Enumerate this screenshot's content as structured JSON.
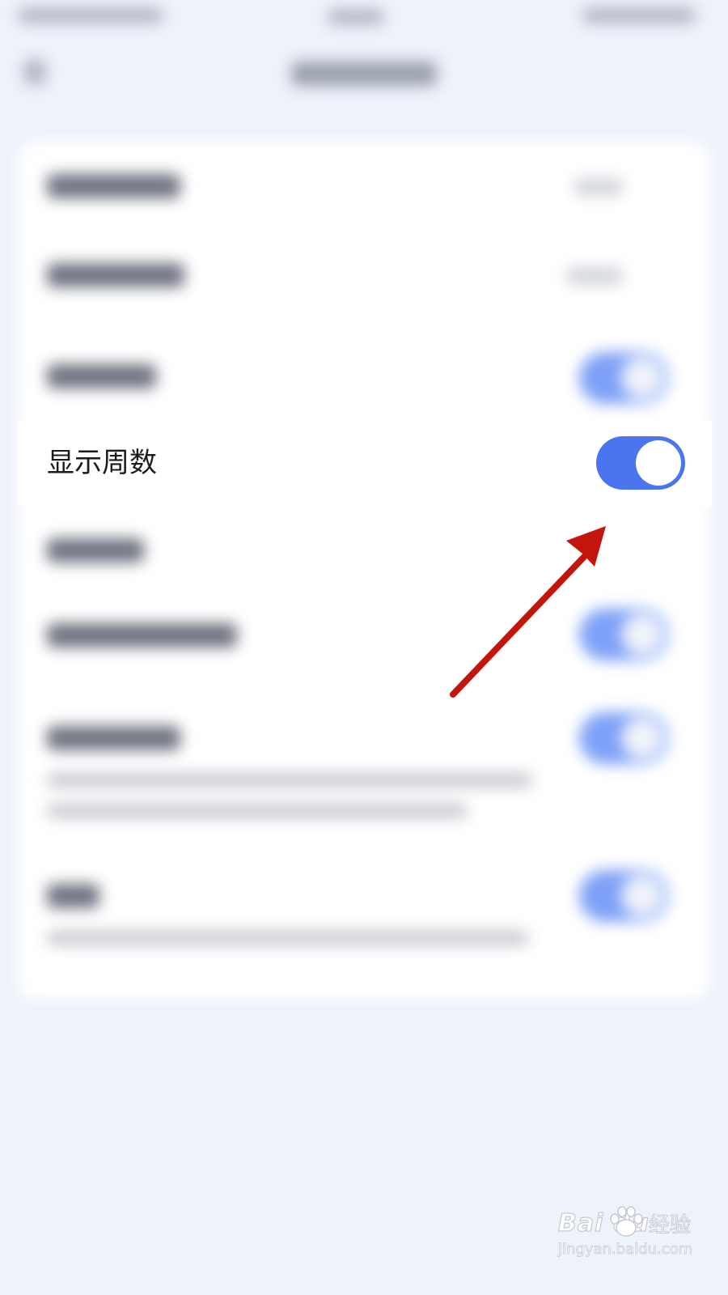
{
  "settings_row": {
    "label": "显示周数",
    "toggle_state": "on"
  },
  "colors": {
    "toggle_on": "#4a75ef",
    "toggle_knob": "#ffffff",
    "annotation_arrow": "#c4150d",
    "background": "#eef2fb"
  },
  "icons": {
    "annotation": "arrow-icon",
    "watermark": "baidu-paw-icon"
  },
  "watermark": {
    "logo_text": "Bai du",
    "cn_text": "经验",
    "url": "jingyan.baidu.com"
  }
}
